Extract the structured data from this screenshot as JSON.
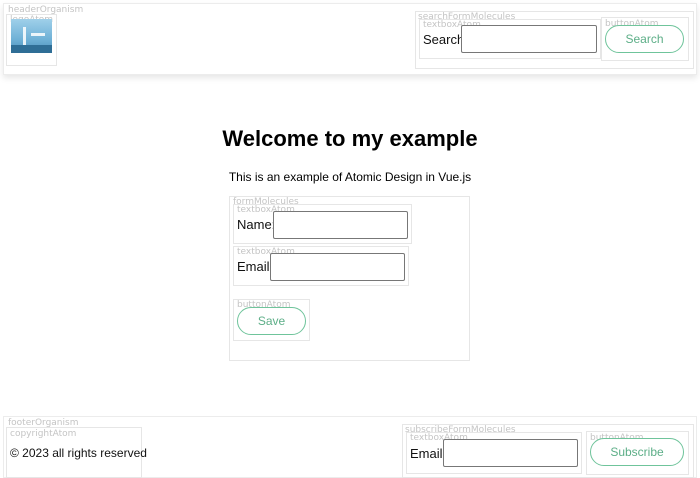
{
  "header": {
    "organism_tag": "headerOrganism",
    "logo_tag": "logoAtom",
    "search_form_tag": "searchFormMolecules",
    "search_textbox_tag": "textboxAtom",
    "search_label": "Search:",
    "search_value": "",
    "search_button_tag": "buttonAtom",
    "search_button_label": "Search"
  },
  "main": {
    "title": "Welcome to my example",
    "subtitle": "This is an example of Atomic Design in Vue.js",
    "form": {
      "tag": "formMolecules",
      "name_textbox_tag": "textboxAtom",
      "name_label": "Name:",
      "name_value": "",
      "email_textbox_tag": "textboxAtom",
      "email_label": "Email:",
      "email_value": "",
      "save_button_tag": "buttonAtom",
      "save_label": "Save"
    }
  },
  "footer": {
    "organism_tag": "footerOrganism",
    "copyright_tag": "copyrightAtom",
    "copyright_text": "© 2023 all rights reserved",
    "subscribe_form_tag": "subscribeFormMolecules",
    "email_textbox_tag": "textboxAtom",
    "email_label": "Email:",
    "email_value": "",
    "subscribe_button_tag": "buttonAtom",
    "subscribe_label": "Subscribe"
  },
  "colors": {
    "accent_green": "#5cae87",
    "outline_gray": "#e6e6e6"
  }
}
